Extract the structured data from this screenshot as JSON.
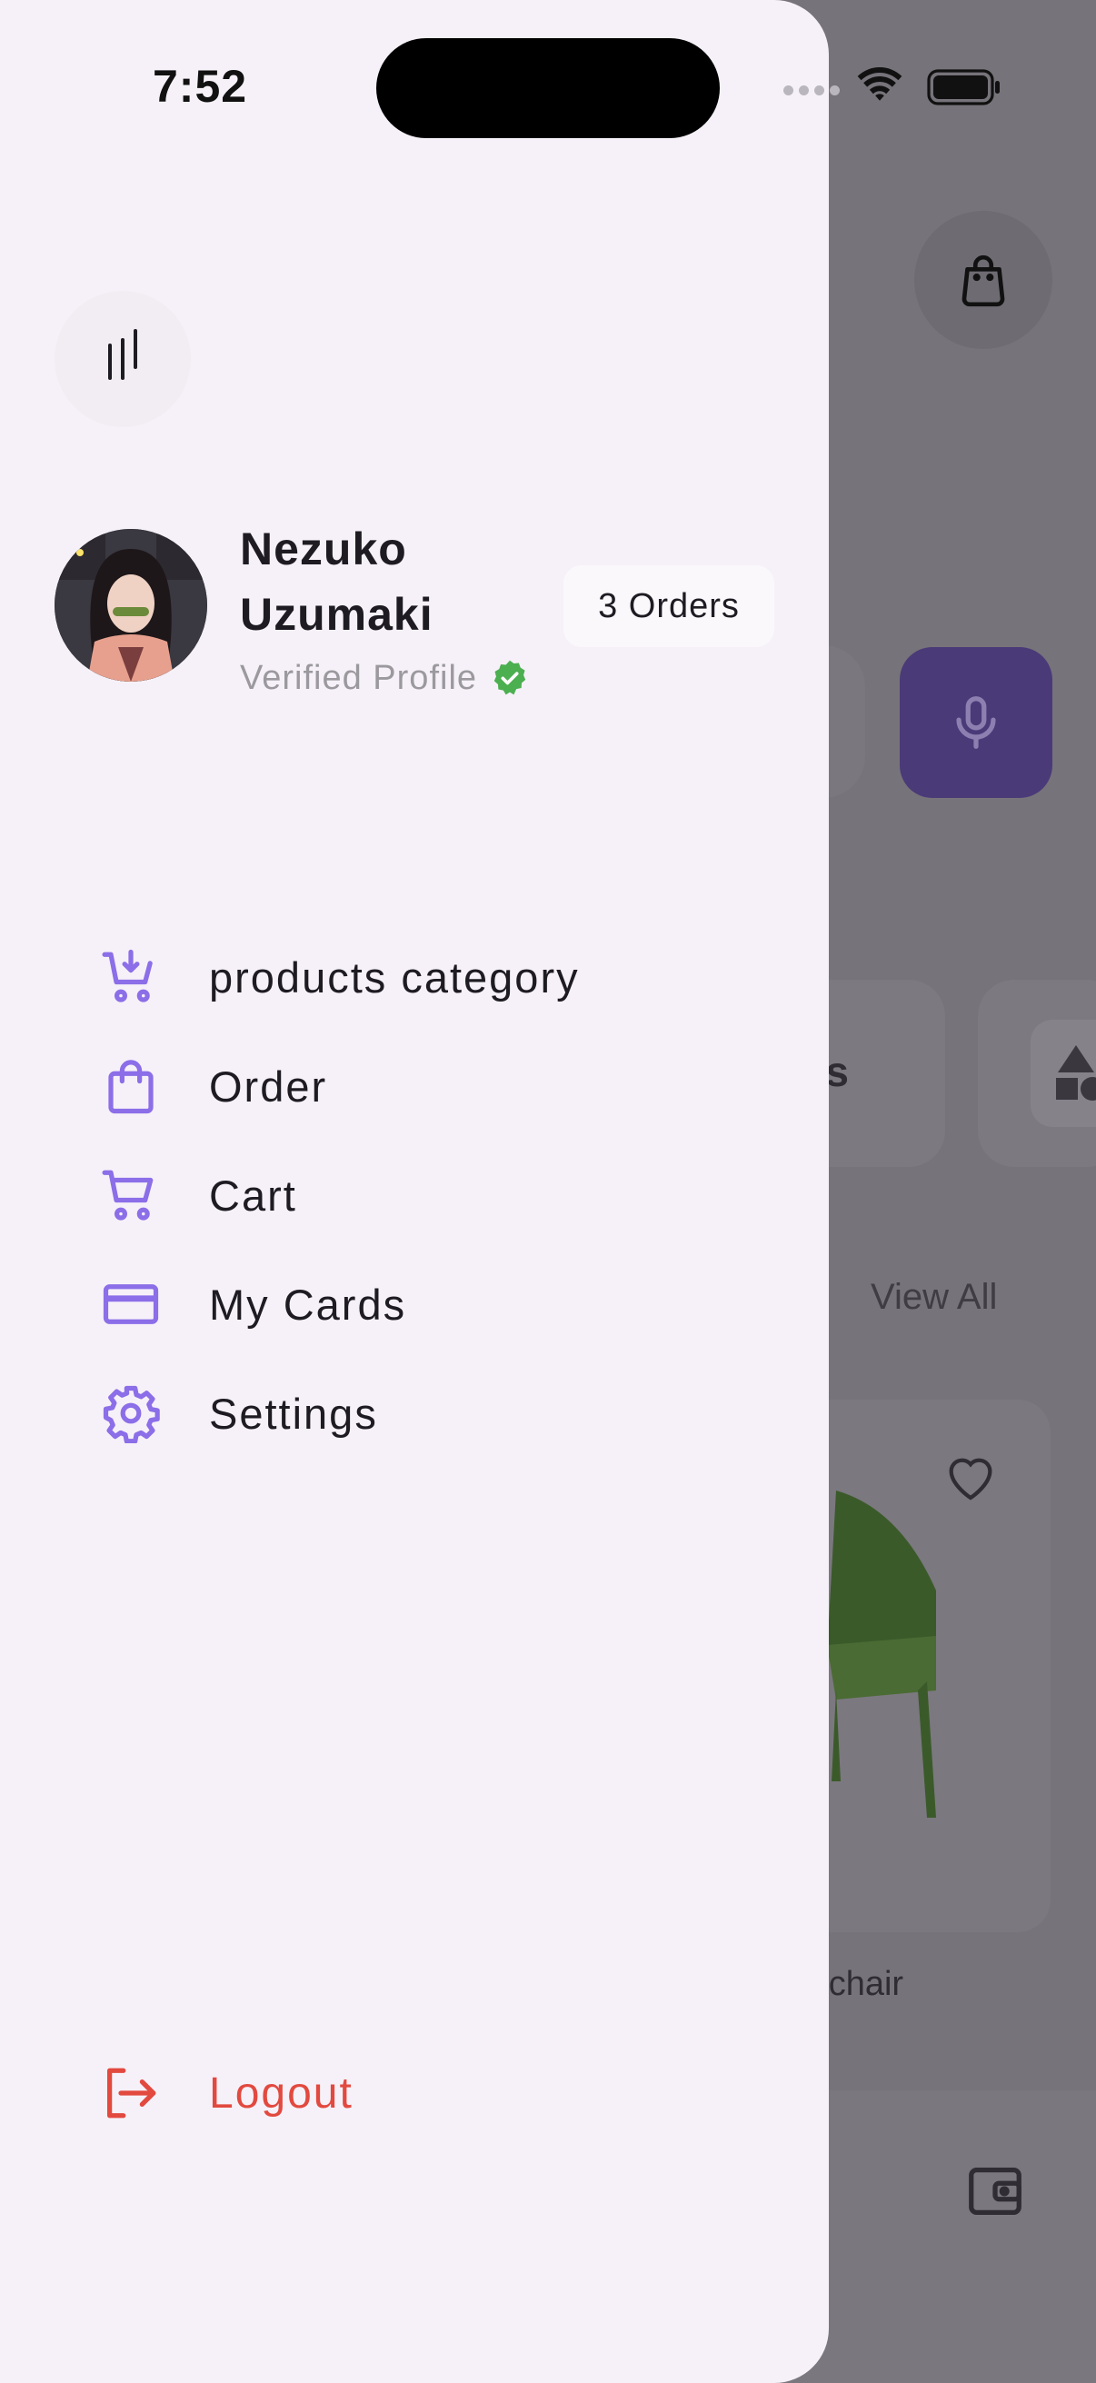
{
  "status_bar": {
    "time": "7:52"
  },
  "drawer": {
    "user": {
      "name": "Nezuko Uzumaki",
      "verified_text": "Verified Profile",
      "orders_badge": "3 Orders"
    },
    "menu_items": [
      {
        "label": "products category",
        "icon": "cart-download-icon"
      },
      {
        "label": "Order",
        "icon": "shopping-bag-icon"
      },
      {
        "label": "Cart",
        "icon": "cart-icon"
      },
      {
        "label": "My Cards",
        "icon": "credit-card-icon"
      },
      {
        "label": "Settings",
        "icon": "gear-icon"
      }
    ],
    "logout_label": "Logout"
  },
  "background": {
    "category_label": "ies",
    "view_all": "View All",
    "product_name": "n chair"
  },
  "colors": {
    "accent": "#8b6ee8",
    "logout": "#e2493f",
    "verified": "#4caf50",
    "drawer_bg": "#f6f1f8",
    "mic_bg": "#4a3a78"
  }
}
